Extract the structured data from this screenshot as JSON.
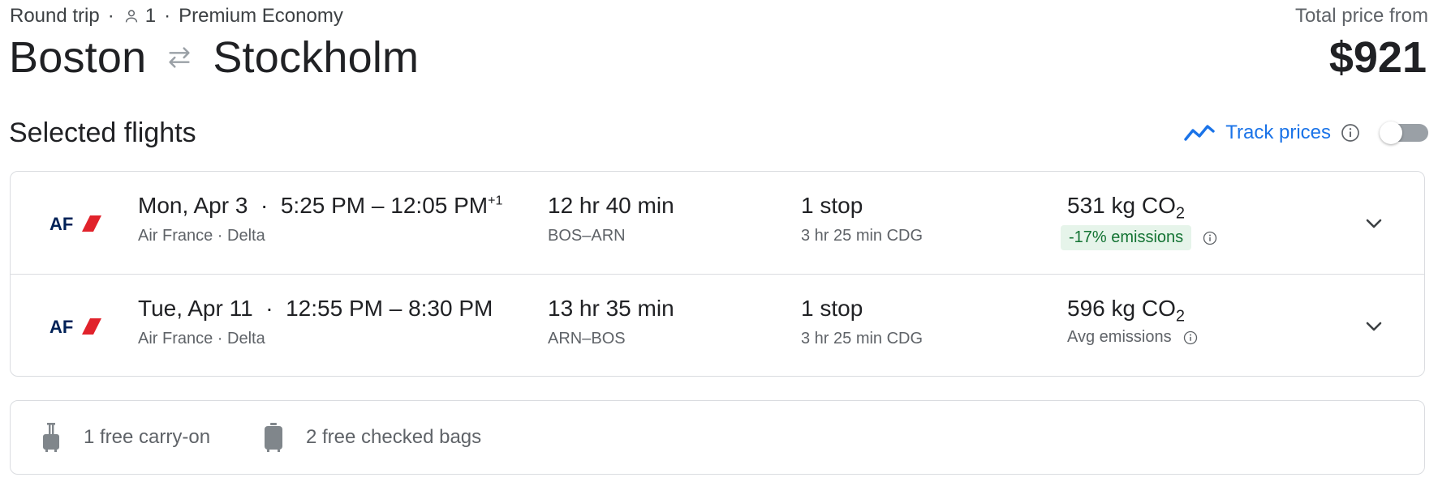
{
  "header": {
    "trip_type": "Round trip",
    "passengers": "1",
    "cabin": "Premium Economy",
    "origin": "Boston",
    "destination": "Stockholm",
    "total_label": "Total price from",
    "total_price": "$921"
  },
  "section": {
    "title": "Selected flights",
    "track_prices_label": "Track prices",
    "track_prices_enabled": false
  },
  "flights": [
    {
      "date": "Mon, Apr 3",
      "time_range": "5:25 PM – 12:05 PM",
      "day_offset": "+1",
      "airlines": "Air France · Delta",
      "duration": "12 hr 40 min",
      "route": "BOS–ARN",
      "stops": "1 stop",
      "layover": "3 hr 25 min CDG",
      "emissions_value": "531 kg CO",
      "emissions_badge": "-17% emissions"
    },
    {
      "date": "Tue, Apr 11",
      "time_range": "12:55 PM – 8:30 PM",
      "day_offset": "",
      "airlines": "Air France · Delta",
      "duration": "13 hr 35 min",
      "route": "ARN–BOS",
      "stops": "1 stop",
      "layover": "3 hr 25 min CDG",
      "emissions_value": "596 kg CO",
      "emissions_note": "Avg emissions"
    }
  ],
  "bags": {
    "carry_on": "1 free carry-on",
    "checked": "2 free checked bags"
  },
  "colors": {
    "accent": "#1a73e8",
    "airline_blue": "#002157",
    "airline_red": "#e1222b",
    "badge_bg": "#e6f4ea",
    "badge_text": "#137333",
    "border": "#dadce0"
  },
  "icons": {
    "person": "person-icon",
    "swap": "swap-arrows-icon",
    "trend": "trend-line-icon",
    "info": "info-icon",
    "chevron": "chevron-down-icon",
    "carry_on": "carry-on-bag-icon",
    "checked_bag": "checked-bag-icon"
  }
}
